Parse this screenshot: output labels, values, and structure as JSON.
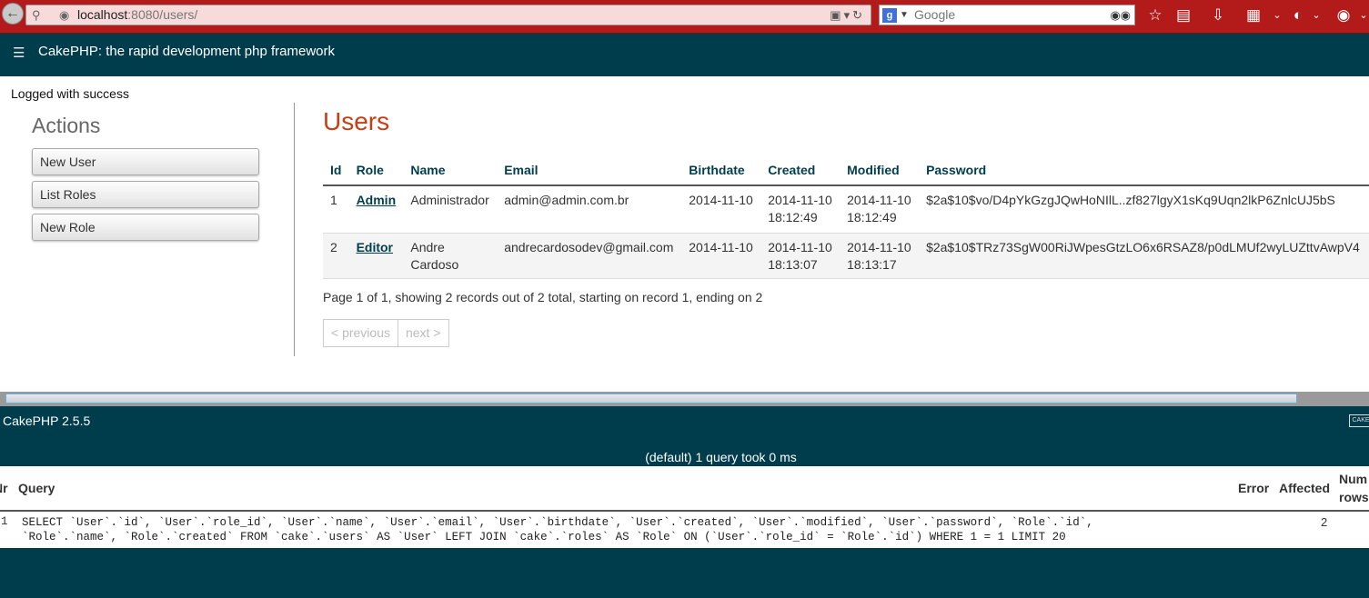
{
  "browser": {
    "url_host": "localhost",
    "url_rest": ":8080/users/",
    "search_placeholder": "Google"
  },
  "header": {
    "title": "CakePHP: the rapid development php framework"
  },
  "flash": "Logged with success",
  "actions": {
    "heading": "Actions",
    "items": [
      "New User",
      "List Roles",
      "New Role"
    ]
  },
  "users": {
    "heading": "Users",
    "columns": [
      "Id",
      "Role",
      "Name",
      "Email",
      "Birthdate",
      "Created",
      "Modified",
      "Password"
    ],
    "rows": [
      {
        "id": "1",
        "role": "Admin",
        "name": "Administrador",
        "name2": "",
        "email": "admin@admin.com.br",
        "birthdate": "2014-11-10",
        "created_date": "2014-11-10",
        "created_time": "18:12:49",
        "modified_date": "2014-11-10",
        "modified_time": "18:12:49",
        "password": "$2a$10$vo/D4pYkGzgJQwHoNIlL..zf827lgyX1sKq9Uqn2lkP6ZnlcUJ5bS"
      },
      {
        "id": "2",
        "role": "Editor",
        "name": "Andre",
        "name2": "Cardoso",
        "email": "andrecardosodev@gmail.com",
        "birthdate": "2014-11-10",
        "created_date": "2014-11-10",
        "created_time": "18:13:07",
        "modified_date": "2014-11-10",
        "modified_time": "18:13:17",
        "password": "$2a$10$TRz73SgW00RiJWpesGtzLO6x6RSAZ8/p0dLMUf2wyLUZttvAwpV4"
      }
    ],
    "paging_text": "Page 1 of 1, showing 2 records out of 2 total, starting on record 1, ending on 2",
    "prev_label": "< previous",
    "next_label": "next >"
  },
  "footer": {
    "version": "CakePHP 2.5.5",
    "cake_icon_text": "CAKE",
    "query_summary": "(default) 1 query took 0 ms"
  },
  "sql_log": {
    "columns": {
      "nr": "Nr",
      "query": "Query",
      "error": "Error",
      "affected": "Affected",
      "num_rows_1": "Num",
      "num_rows_2": "rows"
    },
    "rows": [
      {
        "nr": "1",
        "query_line1": "SELECT `User`.`id`, `User`.`role_id`, `User`.`name`, `User`.`email`, `User`.`birthdate`, `User`.`created`, `User`.`modified`, `User`.`password`, `Role`.`id`,",
        "query_line2": "`Role`.`name`, `Role`.`created` FROM `cake`.`users` AS `User` LEFT JOIN `cake`.`roles` AS `Role` ON (`User`.`role_id` = `Role`.`id`) WHERE 1 = 1 LIMIT 20",
        "error": "",
        "affected": "2"
      }
    ]
  }
}
